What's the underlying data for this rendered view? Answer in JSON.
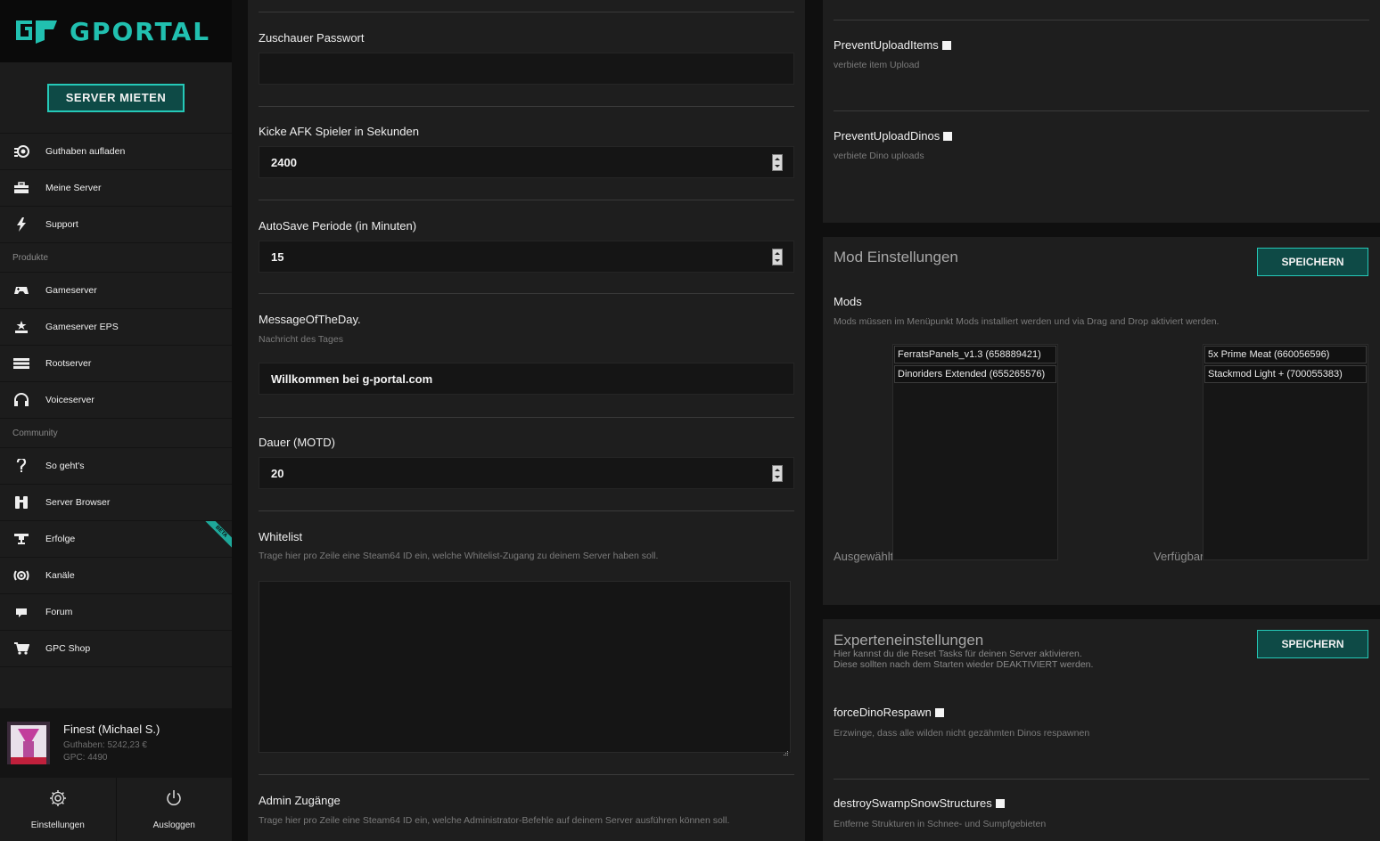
{
  "brand": {
    "name": "GPORTAL",
    "accent": "#21c0b0"
  },
  "sidebar": {
    "rent_button": "SERVER MIETEN",
    "items_top": [
      {
        "label": "Guthaben aufladen",
        "icon": "coins-icon"
      },
      {
        "label": "Meine Server",
        "icon": "toolbox-icon"
      },
      {
        "label": "Support",
        "icon": "lightning-icon"
      }
    ],
    "section_products": "Produkte",
    "items_products": [
      {
        "label": "Gameserver",
        "icon": "gamepad-icon"
      },
      {
        "label": "Gameserver EPS",
        "icon": "eps-stars-icon"
      },
      {
        "label": "Rootserver",
        "icon": "server-rack-icon"
      },
      {
        "label": "Voiceserver",
        "icon": "headset-icon"
      }
    ],
    "section_community": "Community",
    "items_community": [
      {
        "label": "So geht's",
        "icon": "question-hook-icon"
      },
      {
        "label": "Server Browser",
        "icon": "binoculars-icon"
      },
      {
        "label": "Erfolge",
        "icon": "trophy-icon",
        "badge": "BETA"
      },
      {
        "label": "Kanäle",
        "icon": "channels-icon"
      },
      {
        "label": "Forum",
        "icon": "chat-bubble-icon"
      },
      {
        "label": "GPC Shop",
        "icon": "cart-icon"
      }
    ],
    "user": {
      "name": "Finest (Michael S.)",
      "credit": "Guthaben: 5242,23 €",
      "gpc": "GPC: 4490"
    },
    "settings_label": "Einstellungen",
    "logout_label": "Ausloggen"
  },
  "middle": {
    "spectator_password": {
      "label": "Zuschauer Passwort",
      "value": ""
    },
    "kick_afk": {
      "label": "Kicke AFK Spieler in Sekunden",
      "value": "2400"
    },
    "autosave": {
      "label": "AutoSave Periode (in Minuten)",
      "value": "15"
    },
    "motd": {
      "label": "MessageOfTheDay.",
      "help": "Nachricht des Tages",
      "value": "Willkommen bei g-portal.com"
    },
    "motd_duration": {
      "label": "Dauer (MOTD)",
      "value": "20"
    },
    "whitelist": {
      "label": "Whitelist",
      "help": "Trage hier pro Zeile eine Steam64 ID ein, welche Whitelist-Zugang zu deinem Server haben soll.",
      "value": ""
    },
    "admin": {
      "label": "Admin Zugänge",
      "help": "Trage hier pro Zeile eine Steam64 ID ein, welche Administrator-Befehle auf deinem Server ausführen können soll."
    }
  },
  "right_top": {
    "prevent_items": {
      "label": "PreventUploadItems",
      "help": "verbiete item Upload"
    },
    "prevent_dinos": {
      "label": "PreventUploadDinos",
      "help": "verbiete Dino uploads"
    }
  },
  "mods": {
    "title": "Mod Einstellungen",
    "save": "SPEICHERN",
    "label": "Mods",
    "help": "Mods müssen im Menüpunkt Mods installiert werden und via Drag and Drop aktiviert werden.",
    "selected_label": "Ausgewählt",
    "available_label": "Verfügbar",
    "selected": [
      "FerratsPanels_v1.3 (658889421)",
      "Dinoriders Extended (655265576)"
    ],
    "available": [
      "5x Prime Meat (660056596)",
      "Stackmod Light + (700055383)"
    ]
  },
  "expert": {
    "title": "Experteneinstellungen",
    "desc1": "Hier kannst du die Reset Tasks für deinen Server aktivieren.",
    "desc2": "Diese sollten nach dem Starten wieder DEAKTIVIERT werden.",
    "save": "SPEICHERN",
    "force_respawn": {
      "label": "forceDinoRespawn",
      "help": "Erzwinge, dass alle wilden nicht gezähmten Dinos respawnen"
    },
    "destroy_swamp": {
      "label": "destroySwampSnowStructures",
      "help": "Entferne Strukturen in Schnee- und Sumpfgebieten"
    }
  }
}
